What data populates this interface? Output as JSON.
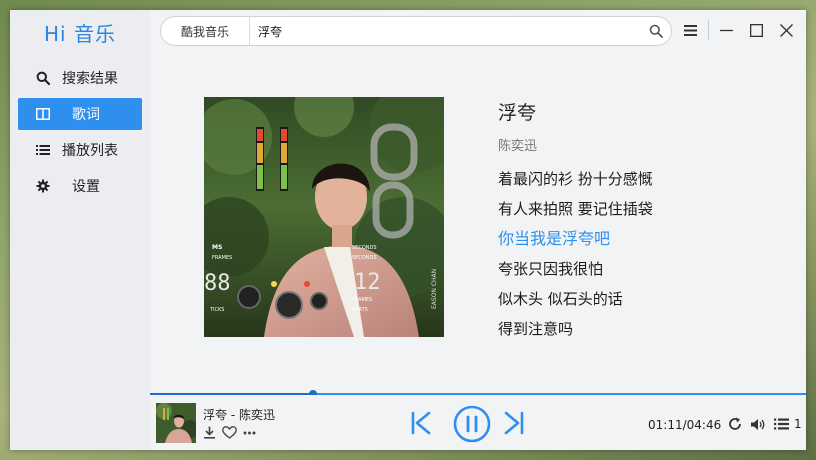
{
  "app": {
    "brand": "Hi 音乐"
  },
  "sidebar": {
    "items": [
      {
        "label": "搜索结果",
        "icon": "search-icon",
        "active": false
      },
      {
        "label": "歌词",
        "icon": "book-icon",
        "active": true
      },
      {
        "label": "播放列表",
        "icon": "list-icon",
        "active": false
      },
      {
        "label": "设置",
        "icon": "gear-icon",
        "active": false
      }
    ]
  },
  "search": {
    "scope": "酷我音乐",
    "query": "浮夸"
  },
  "window_controls": [
    "menu-icon",
    "minimize-icon",
    "maximize-icon",
    "close-icon"
  ],
  "song": {
    "title": "浮夸",
    "artist": "陈奕迅",
    "lyrics": [
      {
        "text": "着最闪的衫 扮十分感慨",
        "current": false
      },
      {
        "text": "有人来拍照 要记住插袋",
        "current": false
      },
      {
        "text": "你当我是浮夸吧",
        "current": true
      },
      {
        "text": "夸张只因我很怕",
        "current": false
      },
      {
        "text": "似木头 似石头的话",
        "current": false
      },
      {
        "text": "得到注意吗",
        "current": false
      }
    ]
  },
  "cover_art_text": {
    "left_top": "MS",
    "left_mid": "FRAMES",
    "left_digits": "88",
    "left_bottom": "TICKS",
    "right_top": "SECONDS",
    "right_mid": "SECONDS",
    "right_digits": "12",
    "right_label": "FRAMES",
    "right_bottom": "BEATS",
    "vertical": "EASON CHAN"
  },
  "player": {
    "now_playing": "浮夸 - 陈奕迅",
    "elapsed": "01:11",
    "duration": "04:46",
    "time_display": "01:11/04:46",
    "progress": 0.2483,
    "queue_count": "1"
  },
  "colors": {
    "accent": "#2f8fee",
    "sidebar_bg": "#ebedf0",
    "content_bg": "#f1f3f5",
    "current_lyric": "#2f8fee"
  }
}
